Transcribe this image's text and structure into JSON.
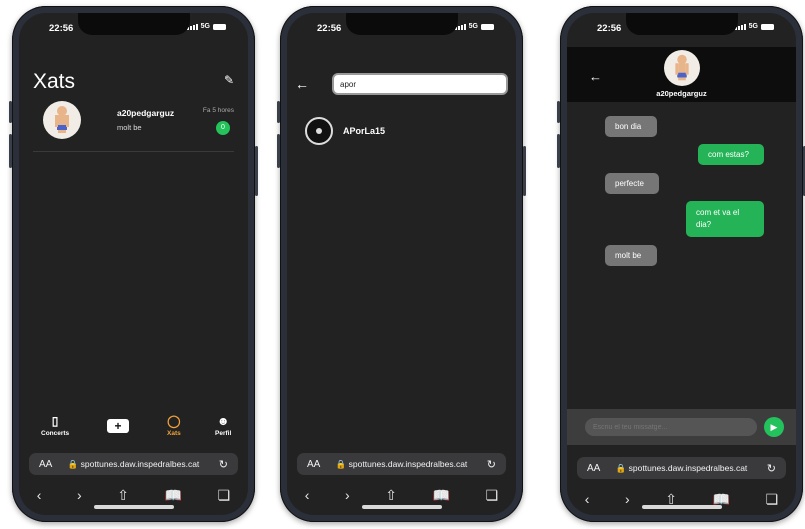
{
  "phone1": {
    "time": "22:56",
    "network": "5G",
    "title": "Xats",
    "chat": {
      "name": "a20pedgarguz",
      "last_message": "molt be",
      "time_ago": "Fa 5 hores",
      "unread": "0"
    },
    "tabs": [
      {
        "label": "Concerts",
        "icon": "ticket-icon"
      },
      {
        "label": "",
        "icon": "plus-icon"
      },
      {
        "label": "Xats",
        "icon": "chat-bubble-icon",
        "active": true
      },
      {
        "label": "Perfil",
        "icon": "user-icon"
      }
    ],
    "url": "spottunes.daw.inspedralbes.cat",
    "aa": "AA"
  },
  "phone2": {
    "time": "22:56",
    "network": "5G",
    "search_value": "apor",
    "result_name": "APorLa15",
    "url": "spottunes.daw.inspedralbes.cat",
    "aa": "AA"
  },
  "phone3": {
    "time": "22:56",
    "network": "5G",
    "contact_name": "a20pedgarguz",
    "messages": [
      {
        "text": "bon dia",
        "direction": "in"
      },
      {
        "text": "com estas?",
        "direction": "out"
      },
      {
        "text": "perfecte",
        "direction": "in"
      },
      {
        "text": "com et va el dia?",
        "direction": "out"
      },
      {
        "text": "molt be",
        "direction": "in"
      }
    ],
    "input_placeholder": "Escriu el teu missatge...",
    "url": "spottunes.daw.inspedralbes.cat",
    "aa": "AA"
  },
  "colors": {
    "screen_bg": "#222222",
    "accent_active_tab": "#f0a23b",
    "sent_bubble": "#24b457",
    "received_bubble": "#767676",
    "unread_badge": "#23c25a"
  }
}
